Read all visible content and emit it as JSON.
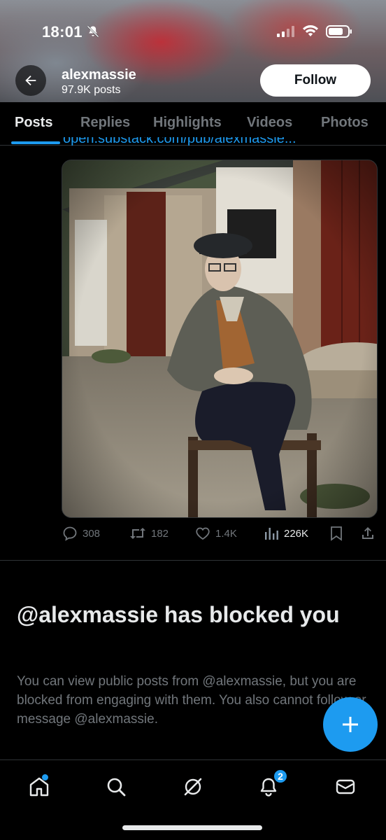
{
  "status_bar": {
    "time": "18:01"
  },
  "header": {
    "profile_name": "alexmassie",
    "post_count": "97.9K posts",
    "follow_label": "Follow"
  },
  "tabs": [
    {
      "label": "Posts",
      "active": true
    },
    {
      "label": "Replies",
      "active": false
    },
    {
      "label": "Highlights",
      "active": false
    },
    {
      "label": "Videos",
      "active": false
    },
    {
      "label": "Photos",
      "active": false
    }
  ],
  "post": {
    "link_text": "open.substack.com/pub/alexmassie...",
    "replies": "308",
    "reposts": "182",
    "likes": "1.4K",
    "views": "226K"
  },
  "blocked_notice": {
    "title": "@alexmassie has blocked you",
    "body": "You can view public posts from @alexmassie, but you are blocked from engaging with them. You also cannot follow or message @alexmassie."
  },
  "bottom_nav": {
    "notification_count": "2"
  },
  "colors": {
    "accent": "#1d9bf0",
    "background": "#000000",
    "muted_text": "#71767b"
  },
  "icons": [
    "back-arrow-icon",
    "bell-off-icon",
    "signal-icon",
    "wifi-icon",
    "battery-icon",
    "reply-icon",
    "repost-icon",
    "like-icon",
    "views-icon",
    "bookmark-icon",
    "share-icon",
    "plus-icon",
    "home-icon",
    "search-icon",
    "grok-icon",
    "bell-icon",
    "mail-icon"
  ]
}
